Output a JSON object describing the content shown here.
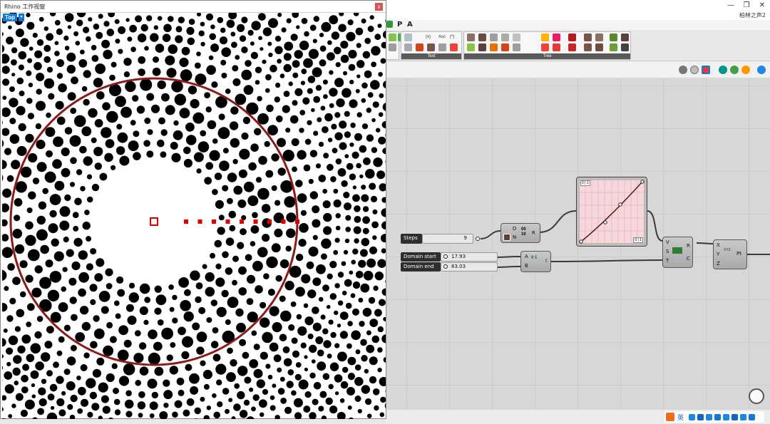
{
  "rhino": {
    "window_title": "Rhino 工作视窗",
    "close_label": "x",
    "viewport_label": "Top",
    "viewport_arrow": "▾"
  },
  "grasshopper": {
    "window_title": "柏林之声2",
    "window_controls": [
      "—",
      "❐",
      "✕"
    ],
    "menu": [
      "P",
      "A"
    ],
    "ribbon_panels": [
      "Text",
      "Tree"
    ],
    "ribbon_text_icons": [
      "(x)",
      "Asc",
      "(*)"
    ],
    "components": {
      "steps": {
        "label": "Steps",
        "value": "9"
      },
      "domain_start": {
        "label": "Domain start",
        "value": "17.93"
      },
      "domain_end": {
        "label": "Domain end",
        "value": "83.03"
      },
      "range": {
        "inputs": [
          "D",
          "N"
        ],
        "output": "R",
        "icon_top": "00",
        "icon_bottom": "10"
      },
      "graph_mapper": {
        "tag_top": "0 | 1",
        "tag_bottom": "0 | 1"
      },
      "construct_domain": {
        "inputs": [
          "A",
          "B"
        ],
        "output": "I",
        "icon": "0 1"
      },
      "sub_curve": {
        "inputs": [
          "V",
          "S",
          "T"
        ],
        "outputs": [
          "R",
          "C"
        ]
      },
      "construct_point": {
        "inputs": [
          "X",
          "Y",
          "Z"
        ],
        "output": "Pt",
        "icon": "XYZ"
      }
    },
    "ime_label": "英",
    "colors": {
      "accent": "#1478d4",
      "circle": "#8b1a1a",
      "marker": "#e00000",
      "wire": "#3a3a3a"
    }
  }
}
